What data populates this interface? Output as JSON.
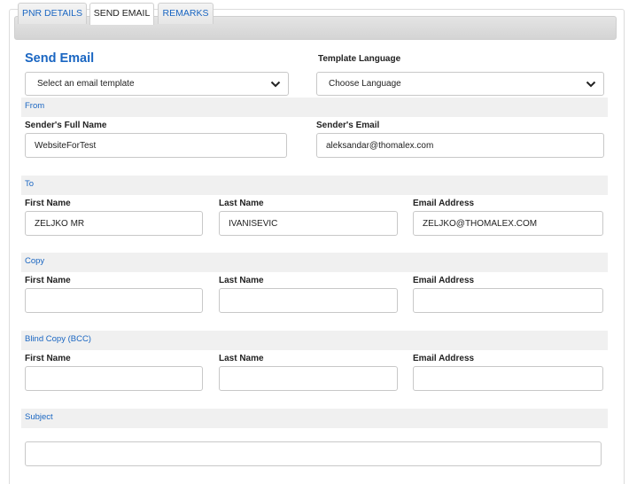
{
  "tabs": [
    {
      "label": "PNR DETAILS"
    },
    {
      "label": "SEND EMAIL"
    },
    {
      "label": "REMARKS"
    }
  ],
  "title": "Send Email",
  "template": {
    "value": "Select an email template"
  },
  "language": {
    "label": "Template Language",
    "value": "Choose Language"
  },
  "from": {
    "section": "From",
    "name_label": "Sender's Full Name",
    "name_value": "WebsiteForTest",
    "email_label": "Sender's Email",
    "email_value": "aleksandar@thomalex.com"
  },
  "to": {
    "section": "To",
    "first_label": "First Name",
    "last_label": "Last Name",
    "email_label": "Email Address",
    "first_value": "ZELJKO MR",
    "last_value": "IVANISEVIC",
    "email_value": "ZELJKO@THOMALEX.COM"
  },
  "copy": {
    "section": "Copy",
    "first_label": "First Name",
    "last_label": "Last Name",
    "email_label": "Email Address",
    "first_value": "",
    "last_value": "",
    "email_value": ""
  },
  "bcc": {
    "section": "Blind Copy (BCC)",
    "first_label": "First Name",
    "last_label": "Last Name",
    "email_label": "Email Address",
    "first_value": "",
    "last_value": "",
    "email_value": ""
  },
  "subject": {
    "section": "Subject",
    "value": ""
  },
  "colors": {
    "accent": "#1a66c2",
    "section_bg": "#f0f0f0",
    "border": "#c8c8c8"
  }
}
